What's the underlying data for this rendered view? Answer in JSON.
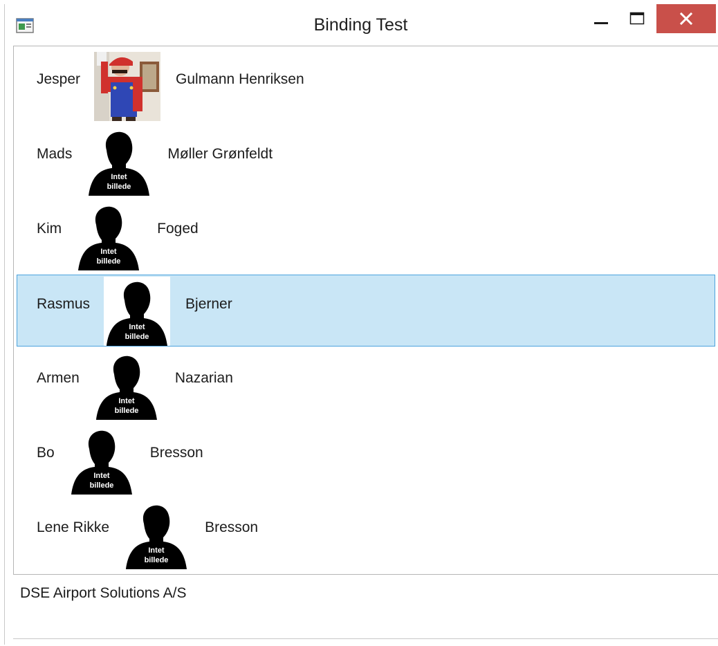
{
  "window": {
    "title": "Binding Test"
  },
  "icons": {
    "app": "app-window-icon",
    "minimize": "minimize-icon",
    "maximize": "maximize-icon",
    "close": "close-icon"
  },
  "colors": {
    "close_button": "#c9504a",
    "selection_bg": "#c9e6f6",
    "selection_border": "#4aa2dd"
  },
  "people": [
    {
      "first": "Jesper",
      "last": "Gulmann Henriksen",
      "photo": "mario-costume-photo"
    },
    {
      "first": "Mads",
      "last": "Møller Grønfeldt",
      "photo": "silhouette-placeholder"
    },
    {
      "first": "Kim",
      "last": "Foged",
      "photo": "silhouette-placeholder"
    },
    {
      "first": "Rasmus",
      "last": "Bjerner",
      "photo": "silhouette-placeholder",
      "selected": true
    },
    {
      "first": "Armen",
      "last": "Nazarian",
      "photo": "silhouette-placeholder"
    },
    {
      "first": "Bo",
      "last": "Bresson",
      "photo": "silhouette-placeholder"
    },
    {
      "first": "Lene Rikke",
      "last": "Bresson",
      "photo": "silhouette-placeholder"
    }
  ],
  "placeholder_caption": {
    "line1": "Intet",
    "line2": "billede"
  },
  "footer": {
    "text": "DSE Airport Solutions A/S"
  }
}
